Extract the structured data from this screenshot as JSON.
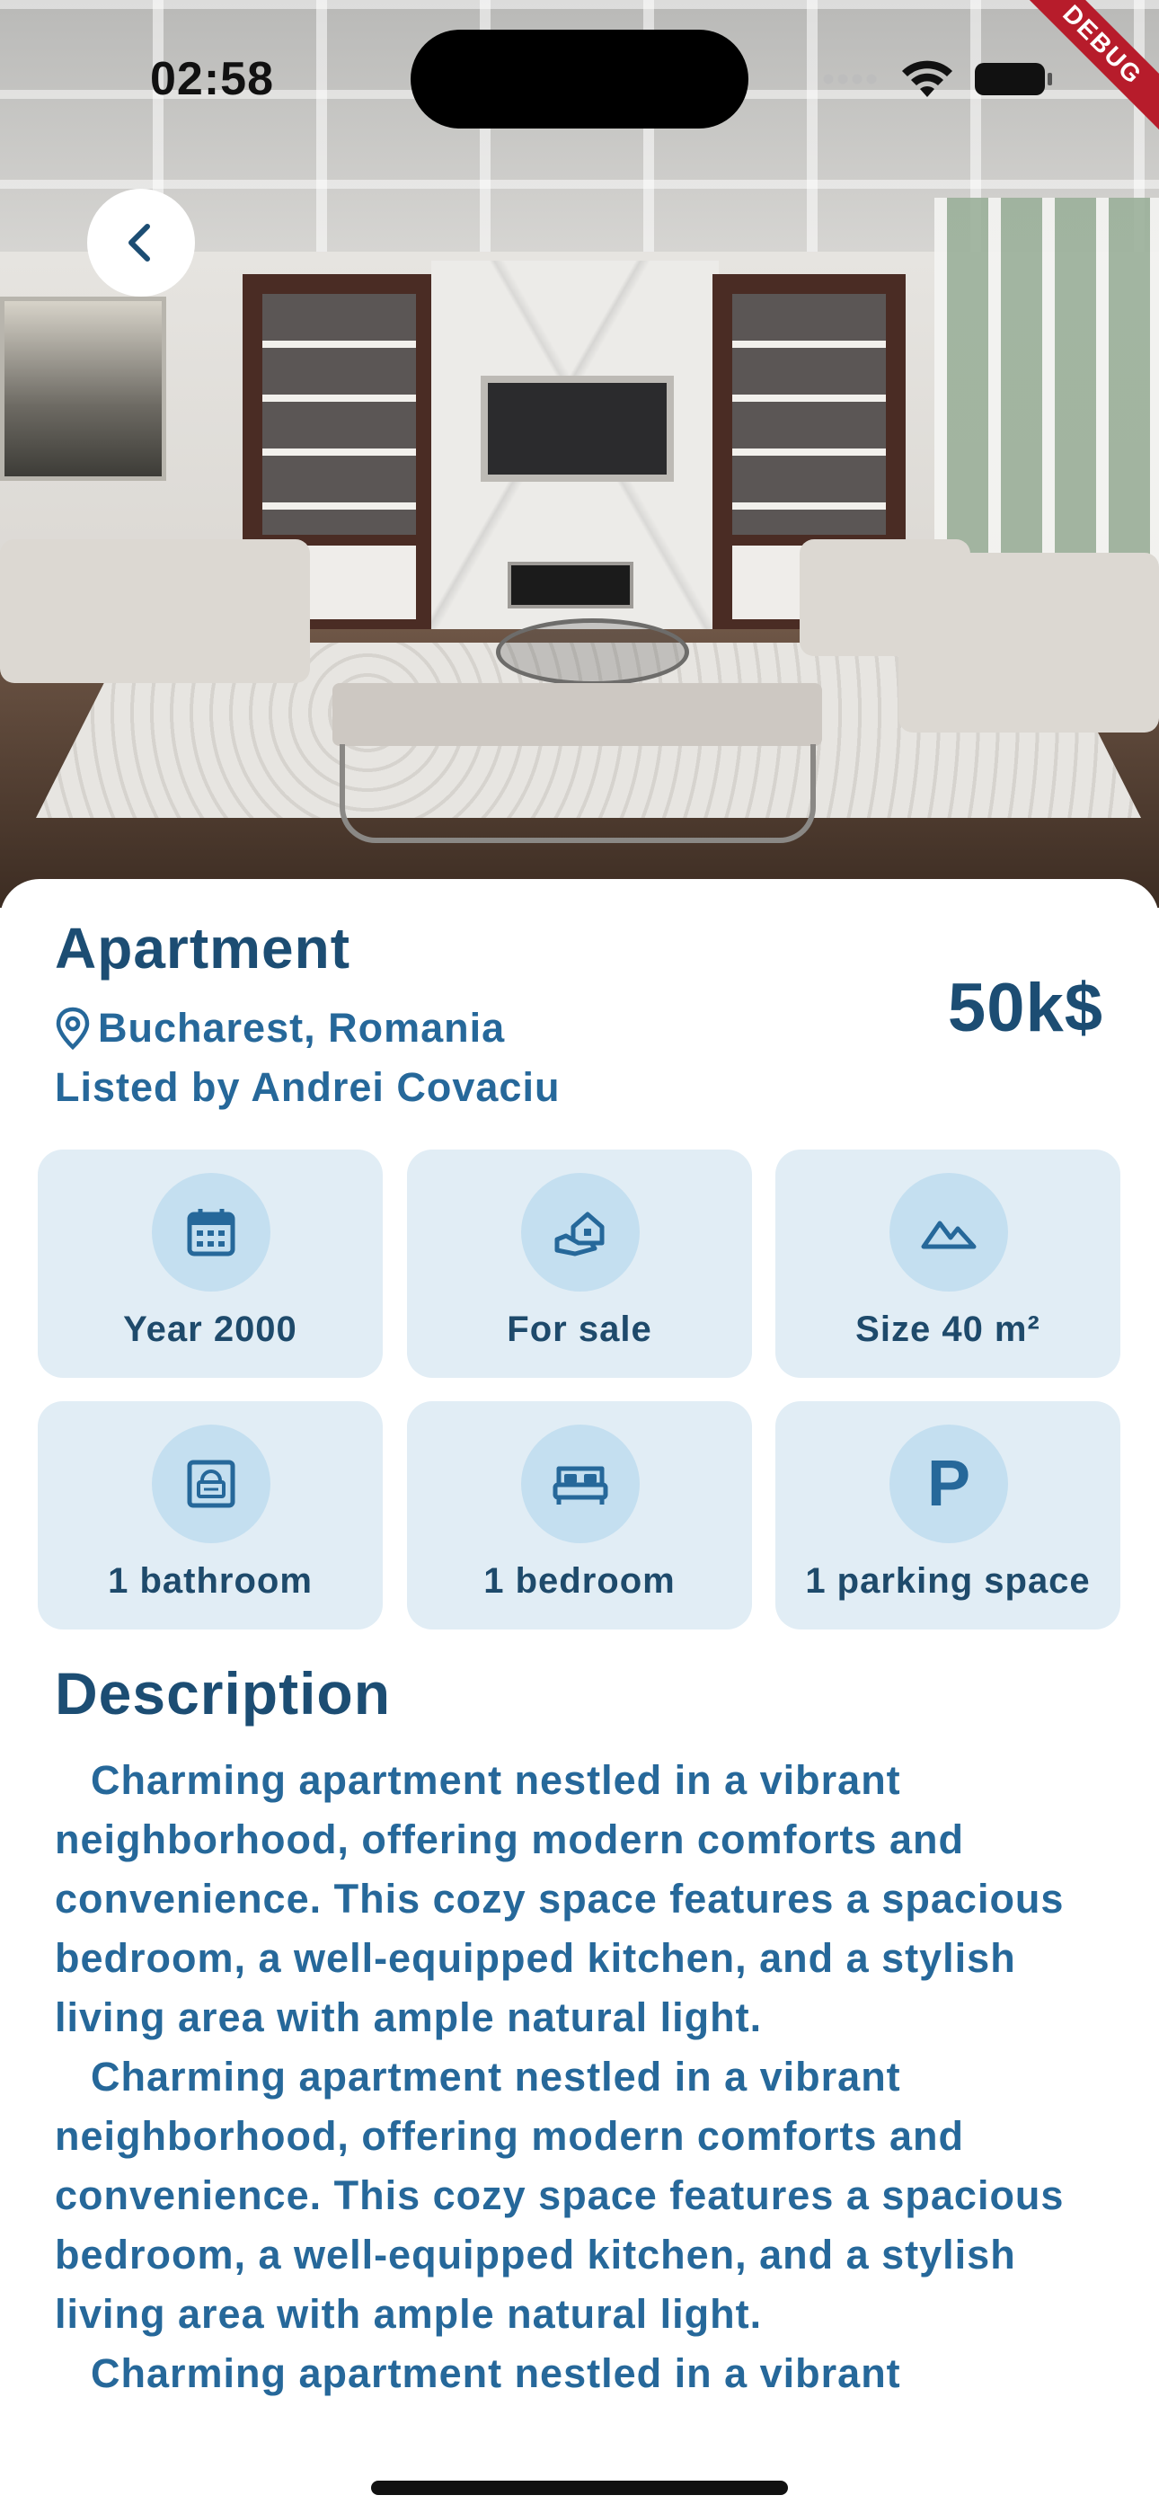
{
  "status_bar": {
    "time": "02:58",
    "debug_banner": "DEBUG"
  },
  "listing": {
    "title": "Apartment",
    "location": "Bucharest, Romania",
    "listed_by": "Listed by Andrei Covaciu",
    "price": "50k$"
  },
  "features": [
    {
      "icon": "calendar-icon",
      "label": "Year 2000"
    },
    {
      "icon": "house-hand-icon",
      "label": "For sale"
    },
    {
      "icon": "landscape-icon",
      "label": "Size 40 m²"
    },
    {
      "icon": "bathroom-icon",
      "label": "1 bathroom"
    },
    {
      "icon": "bed-icon",
      "label": "1 bedroom"
    },
    {
      "icon": "parking-icon",
      "label": "1 parking space",
      "glyph": "P"
    }
  ],
  "description": {
    "heading": "Description",
    "paragraphs": [
      "Charming apartment nestled in a vibrant neighborhood, offering modern comforts and convenience. This cozy space features a spacious bedroom, a well-equipped kitchen, and a stylish living area with ample natural light.",
      "Charming apartment nestled in a vibrant neighborhood, offering modern comforts and convenience. This cozy space features a spacious bedroom, a well-equipped kitchen, and a stylish living area with ample natural light.",
      "Charming apartment nestled in a vibrant"
    ]
  },
  "colors": {
    "primary_dark": "#1c4d73",
    "primary": "#26689a",
    "card_bg": "#e1edf5",
    "icon_circle": "#c4dff0"
  }
}
